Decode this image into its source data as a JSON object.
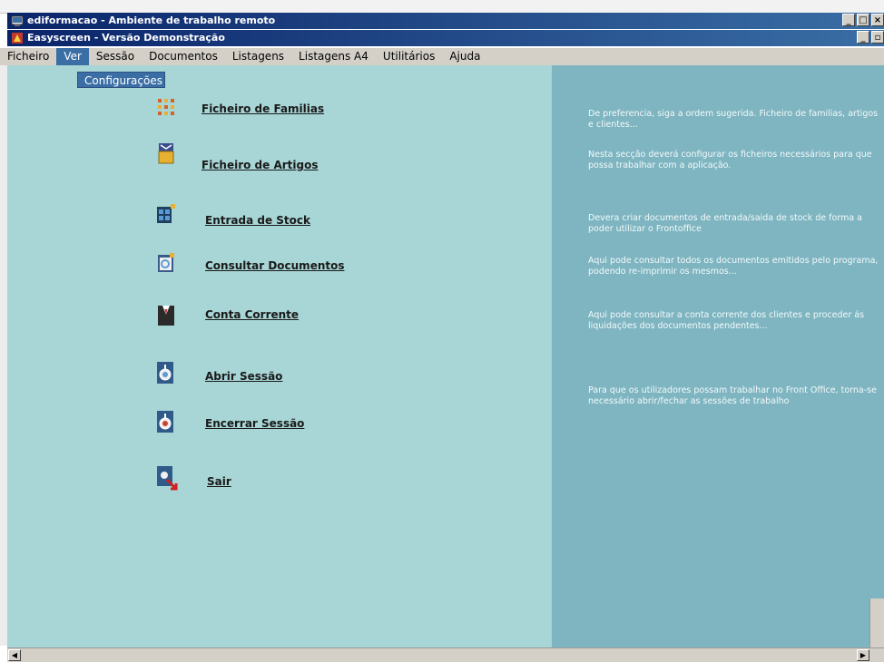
{
  "window": {
    "title": "ediformacao - Ambiente de trabalho remoto",
    "subtitle": "Easyscreen - Versão Demonstração"
  },
  "menu": [
    {
      "label": "Ficheiro"
    },
    {
      "label": "Ver"
    },
    {
      "label": "Sessão"
    },
    {
      "label": "Documentos"
    },
    {
      "label": "Listagens"
    },
    {
      "label": "Listagens A4"
    },
    {
      "label": "Utilitários"
    },
    {
      "label": "Ajuda"
    }
  ],
  "dropdown": {
    "item": "Configurações"
  },
  "nav": [
    {
      "label": "Ficheiro de Familias",
      "icon": "grid-icon"
    },
    {
      "label": "Ficheiro de Artigos",
      "icon": "box-icon"
    },
    {
      "label": "Entrada de Stock",
      "icon": "stock-icon"
    },
    {
      "label": "Consultar Documentos",
      "icon": "document-icon"
    },
    {
      "label": "Conta Corrente",
      "icon": "suit-icon"
    },
    {
      "label": "Abrir Sessão",
      "icon": "open-session-icon"
    },
    {
      "label": "Encerrar Sessão",
      "icon": "close-session-icon"
    },
    {
      "label": "Sair",
      "icon": "exit-icon"
    }
  ],
  "descriptions": [
    "De preferencia, siga a ordem sugerida. Ficheiro de familias, artigos e clientes...",
    "Nesta secção deverá configurar os ficheiros necessários para que  possa trabalhar com a aplicação.",
    "Devera criar documentos de entrada/saida de stock de forma a poder utilizar o Frontoffice",
    "Aqui pode consultar todos os documentos emitidos pelo programa, podendo re-imprimir os mesmos...",
    "Aqui pode consultar a conta corrente dos clientes e proceder ás liquidações dos documentos pendentes...",
    "Para que os utilizadores possam trabalhar no Front Office, torna-se necessário abrir/fechar as sessões de trabalho"
  ],
  "colors": {
    "main_bg": "#a8d5d5",
    "panel_bg": "#7eb5c1",
    "titlebar": "#0a246a",
    "menu_active": "#3a6ea5"
  }
}
